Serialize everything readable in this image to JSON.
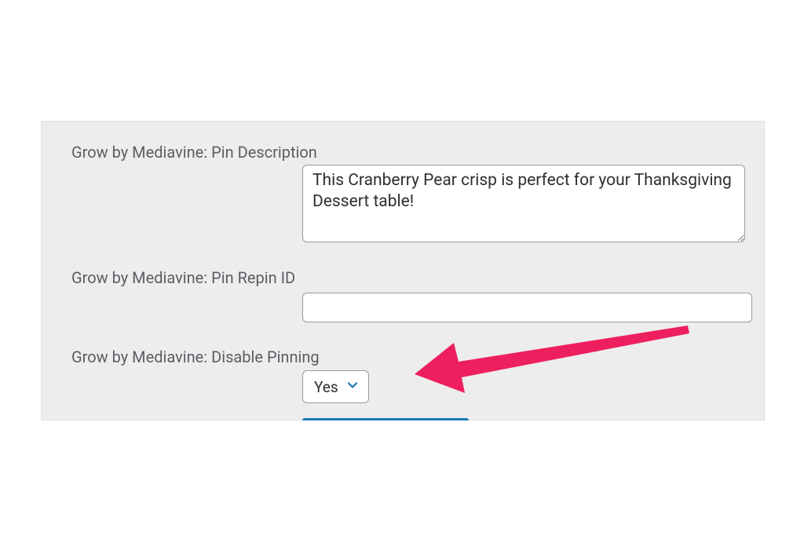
{
  "colors": {
    "panelBg": "#ededed",
    "border": "#9a9a9a",
    "textLabel": "#5a5e64",
    "textInput": "#2c2f33",
    "arrow": "#ee1f5e",
    "blueAccent": "#1b78b5"
  },
  "pinDescription": {
    "label": "Grow by Mediavine: Pin Description",
    "value": "This Cranberry Pear crisp is perfect for your Thanksgiving Dessert table!"
  },
  "pinRepinId": {
    "label": "Grow by Mediavine: Pin Repin ID",
    "value": ""
  },
  "disablePinning": {
    "label": "Grow by Mediavine: Disable Pinning",
    "selected": "Yes"
  }
}
